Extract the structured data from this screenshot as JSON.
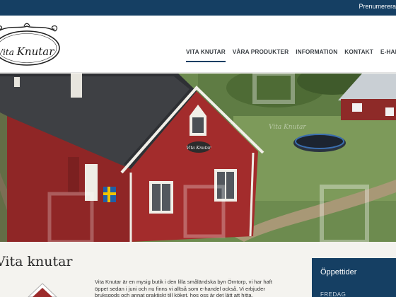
{
  "topbar": {
    "link_label": "Prenumerera"
  },
  "logo": {
    "word1": "Vita",
    "word2": "Knutar"
  },
  "nav": {
    "items": [
      {
        "label": "VITA KNUTAR",
        "active": true
      },
      {
        "label": "VÅRA PRODUKTER",
        "active": false
      },
      {
        "label": "INFORMATION",
        "active": false
      },
      {
        "label": "KONTAKT",
        "active": false
      },
      {
        "label": "E-HANDEL",
        "active": false
      }
    ]
  },
  "hero": {
    "sign_text": "Vita Knutar",
    "watermark": "Vita Knutar"
  },
  "main": {
    "title": "Vita knutar",
    "intro": "Vita Knutar är en mysig butik i den lilla småländska byn Örntorp, vi har haft öppet sedan i juni och nu finns vi alltså som e-handel också. Vi erbjuder bruksgods och annat praktiskt till köket, hos oss är det lätt att hitta."
  },
  "sidebar": {
    "title": "Öppettider",
    "first_day": "FREDAG"
  },
  "colors": {
    "brand": "#153f63",
    "barn_red": "#9c2b2b",
    "roof": "#3d3f43"
  }
}
